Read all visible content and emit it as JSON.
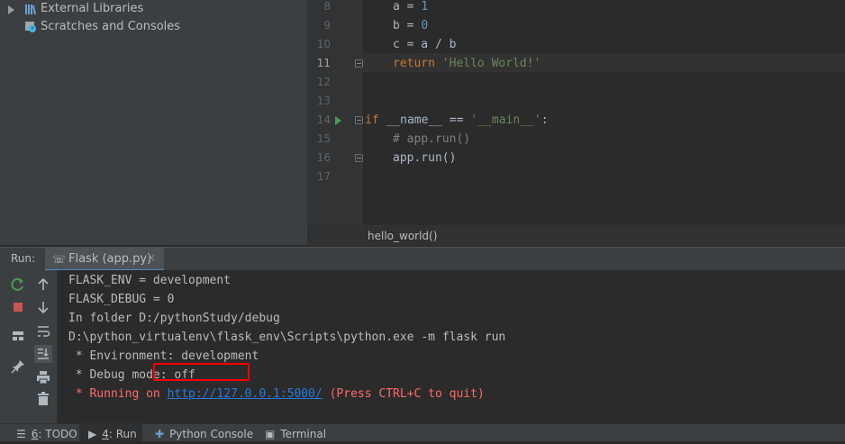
{
  "project_tree": {
    "items": [
      {
        "label": "External Libraries",
        "icon": "library-icon"
      },
      {
        "label": "Scratches and Consoles",
        "icon": "scratches-icon"
      }
    ]
  },
  "editor": {
    "line_numbers": [
      "8",
      "9",
      "10",
      "11",
      "12",
      "13",
      "14",
      "15",
      "16",
      "17"
    ],
    "current_line": "11",
    "code": {
      "l8_var": "a",
      "l8_op": " = ",
      "l8_val": "1",
      "l9_var": "b",
      "l9_op": " = ",
      "l9_val": "0",
      "l10_text": "c = a / b",
      "l11_kw": "return",
      "l11_str": "'Hello World!'",
      "l14_kw": "if",
      "l14_mid": " __name__ == ",
      "l14_str": "'__main__'",
      "l14_end": ":",
      "l15_comment": "# app.run()",
      "l16_text": "app.run()"
    },
    "breadcrumb": "hello_world()"
  },
  "run_panel": {
    "label": "Run:",
    "tab_label": "Flask (app.py)",
    "tab_close": "×",
    "console_lines": [
      {
        "text": "FLASK_ENV = development",
        "type": "normal"
      },
      {
        "text": "FLASK_DEBUG = 0",
        "type": "normal"
      },
      {
        "text": "In folder D:/pythonStudy/debug",
        "type": "normal"
      },
      {
        "text": "D:\\python_virtualenv\\flask_env\\Scripts\\python.exe -m flask run",
        "type": "normal"
      },
      {
        "text": " * Environment: development",
        "type": "normal"
      },
      {
        "text": " * Debug mode: off",
        "type": "normal"
      }
    ],
    "running_prefix": " * Running on ",
    "running_url": "http://127.0.0.1:5000/",
    "running_suffix": " (Press CTRL+C to quit)"
  },
  "bottom_tabs": [
    {
      "num": "6",
      "label": ": TODO",
      "icon": "list-icon"
    },
    {
      "num": "4",
      "label": ": Run",
      "icon": "run-icon"
    },
    {
      "label": "Python Console",
      "icon": "python-icon"
    },
    {
      "label": "Terminal",
      "icon": "terminal-icon"
    }
  ],
  "colors": {
    "keyword": "#cc7832",
    "string": "#6a8759",
    "number": "#6897bb",
    "error": "#ff6b68",
    "link": "#287bde",
    "annotation": "#ff0000"
  }
}
